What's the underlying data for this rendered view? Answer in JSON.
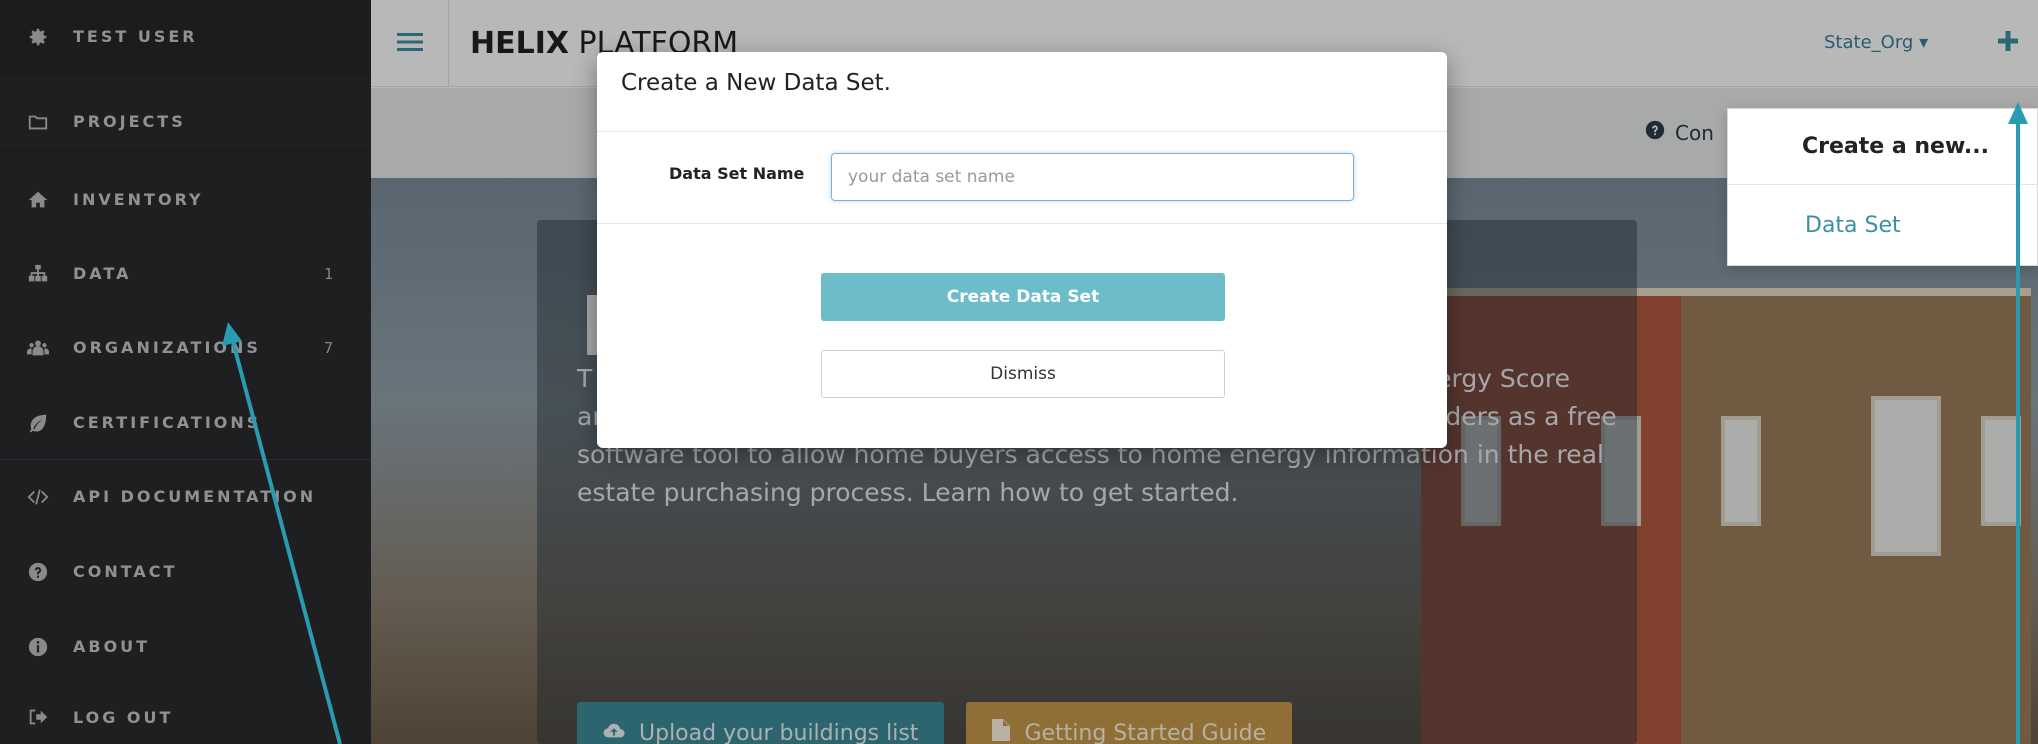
{
  "sidebar": {
    "items": [
      {
        "label": "TEST USER",
        "icon": "gear-icon",
        "count": ""
      },
      {
        "label": "PROJECTS",
        "icon": "folder-icon",
        "count": ""
      },
      {
        "label": "INVENTORY",
        "icon": "home-icon",
        "count": ""
      },
      {
        "label": "DATA",
        "icon": "sitemap-icon",
        "count": "1"
      },
      {
        "label": "ORGANIZATIONS",
        "icon": "users-icon",
        "count": "7"
      },
      {
        "label": "CERTIFICATIONS",
        "icon": "leaf-icon",
        "count": ""
      },
      {
        "label": "API DOCUMENTATION",
        "icon": "code-icon",
        "count": ""
      },
      {
        "label": "CONTACT",
        "icon": "question-circle-icon",
        "count": ""
      },
      {
        "label": "ABOUT",
        "icon": "info-circle-icon",
        "count": ""
      },
      {
        "label": "LOG OUT",
        "icon": "sign-out-icon",
        "count": ""
      }
    ]
  },
  "header": {
    "brand_bold": "HELIX",
    "brand_light": " PLATFORM",
    "org": "State_Org",
    "org_caret": "▾"
  },
  "subbar": {
    "contact": "Con"
  },
  "hero": {
    "text": "T                                                                                                 ase which a                                                                                              nation from the U.S. Department of Energy's Home Energy Score and other sources. The database was developed by regional stakeholders as a free software tool to allow home buyers access to home energy information in the real estate purchasing process. Learn how to get started.",
    "upload_label": "Upload your buildings list",
    "guide_label": "Getting Started Guide"
  },
  "dropdown": {
    "heading": "Create a new...",
    "item": "Data Set"
  },
  "modal": {
    "title": "Create a New Data Set.",
    "field_label": "Data Set Name",
    "input_value": "",
    "input_placeholder": "your data set name",
    "create_label": "Create Data Set",
    "dismiss_label": "Dismiss"
  },
  "colors": {
    "sidebar_bg": "#2a2b2e",
    "accent_teal": "#6cbcc9",
    "link_blue": "#3c8fa5",
    "guide_gold": "#c69a4c",
    "arrow_teal": "#2a9bb0"
  }
}
